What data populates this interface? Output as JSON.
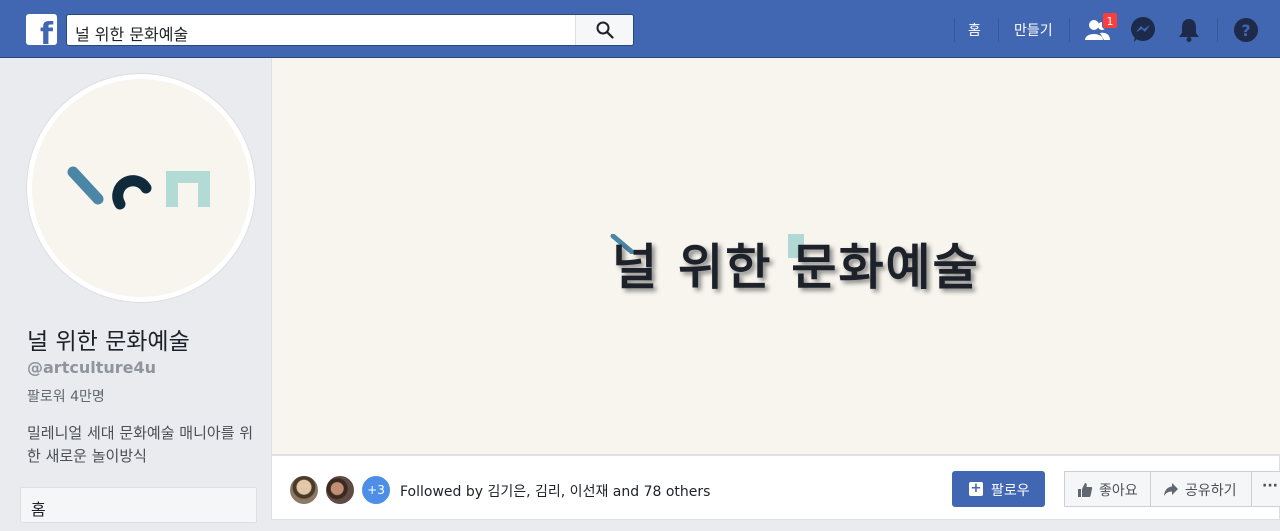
{
  "header": {
    "logo_letter": "f",
    "search_value": "널 위한 문화예술",
    "nav_home": "홈",
    "nav_create": "만들기",
    "friend_requests_badge": "1",
    "colors": {
      "bar": "#4267b2",
      "badge": "#fa3e3e"
    }
  },
  "profile": {
    "name": "널 위한 문화예술",
    "handle": "@artculture4u",
    "followers": "팔로워 4만명",
    "description": "밀레니얼 세대 문화예술 매니아를 위한 새로운 놀이방식",
    "menu_home": "홈"
  },
  "cover": {
    "title": "널 위한 문화예술"
  },
  "actions": {
    "avatar_more": "+3",
    "followed_by": "Followed by 김기은, 김리, 이선재 and 78 others",
    "follow_label": "팔로우",
    "like_label": "좋아요",
    "share_label": "공유하기",
    "more_label": "···"
  }
}
